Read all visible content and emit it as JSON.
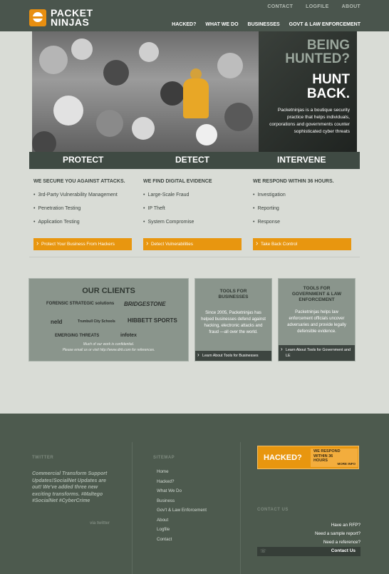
{
  "brand": {
    "line1": "PACKET",
    "line2": "NINJAS"
  },
  "topnav": [
    "CONTACT",
    "LOGFILE",
    "ABOUT"
  ],
  "mainnav": [
    "HACKED?",
    "WHAT WE DO",
    "BUSINESSES",
    "GOVT & LAW ENFORCEMENT"
  ],
  "hero": {
    "being": [
      "BEING",
      "HUNTED?"
    ],
    "hunt": [
      "HUNT",
      "BACK."
    ],
    "description": "Packetninjas is a boutique security practice that helps individuals, corporations and governments counter sophisticated cyber threats"
  },
  "band": [
    "PROTECT",
    "DETECT",
    "INTERVENE"
  ],
  "columns": [
    {
      "heading": "WE SECURE YOU AGAINST ATTACKS.",
      "items": [
        "3rd-Party Vulnerability Management",
        "Penetration Testing",
        "Application Testing"
      ],
      "cta": "Protect Your Business From Hackers"
    },
    {
      "heading": "WE FIND DIGITAL EVIDENCE",
      "items": [
        "Large-Scale Fraud",
        "IP Theft",
        "System Compromise"
      ],
      "cta": "Detect Vulnerabilities"
    },
    {
      "heading": "WE RESPOND WITHIN 36 HOURS.",
      "items": [
        "Investigation",
        "Reporting",
        "Response"
      ],
      "cta": "Take Back Control"
    }
  ],
  "clients": {
    "title": "OUR CLIENTS",
    "logos": [
      "FORENSIC STRATEGIC solutions",
      "BRIDGESTONE",
      "neld",
      "Trumbull City Schools",
      "HIBBETT SPORTS",
      "EMERGING THREATS",
      "infotex"
    ],
    "note_line1": "Much of our work is confidential.",
    "note_line2": "Please email us or visit http://www.dirb.com for references."
  },
  "tools_business": {
    "title_line1": "TOOLS FOR",
    "title_line2": "BUSINESSES",
    "body": "Since 2005, Packetninjas has helped businesses defend against hacking, electronic attacks and fraud —all over the world.",
    "link": "Learn About Tools for Businesses"
  },
  "tools_gov": {
    "title_line1": "TOOLS FOR",
    "title_line2": "GOVERNMENT & LAW",
    "title_line3": "ENFORCEMENT",
    "body": "Packetninjas helps law enforcement officials uncover adversaries and provide legally defensible evidence.",
    "link": "Learn About Tools for Government and LE"
  },
  "footer": {
    "twitter_title": "TWITTER",
    "tweet": "Commercial Transform Support Updates!SocialNet Updates are out! We've added three new exciting transforms. #Maltego #SocialNet #CyberCrime",
    "via": "via twitter",
    "sitemap_title": "SITEMAP",
    "sitemap": [
      "Home",
      "Hacked?",
      "What We Do",
      "Business",
      "Gov't & Law Enforcement",
      "About",
      "Logfile",
      "Contact"
    ],
    "hacked_title": "HACKED?",
    "hacked_text": "WE RESPOND WITHIN 36 HOURS",
    "more_info": "MORE INFO",
    "contact_title": "CONTACT US",
    "contact_lines": [
      "Have an RFP?",
      "Need a sample report?",
      "Need a reference?"
    ],
    "contact_button": "Contact Us"
  }
}
